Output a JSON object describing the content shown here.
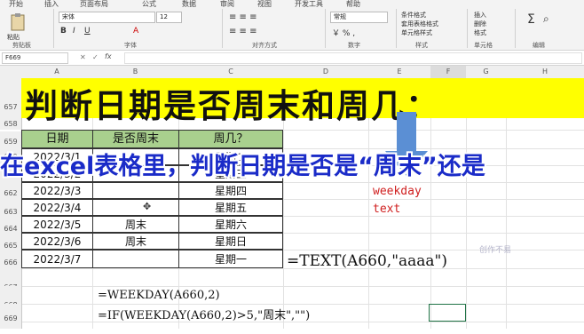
{
  "ribbon": {
    "tabs": [
      "开始",
      "插入",
      "页面布局",
      "公式",
      "数据",
      "审阅",
      "视图",
      "开发工具",
      "帮助"
    ],
    "font_name": "宋体",
    "font_size": "12",
    "number_format": "常规",
    "clipboard_label": "剪贴板",
    "font_label": "字体",
    "align_label": "对齐方式",
    "number_label": "数字",
    "styles_label": "样式",
    "cells_label": "单元格",
    "edit_label": "编辑",
    "cond_format": "条件格式",
    "table_format": "套用表格格式",
    "cell_style": "单元格样式",
    "insert": "插入",
    "delete": "删除",
    "format": "格式",
    "paste": "粘贴"
  },
  "name_box": "F669",
  "columns": [
    "A",
    "B",
    "C",
    "D",
    "E",
    "F",
    "G",
    "H"
  ],
  "rows": [
    "657",
    "658",
    "659",
    "660",
    "661",
    "662",
    "663",
    "664",
    "665",
    "666",
    "667",
    "668",
    "669"
  ],
  "title": "判断日期是否周末和周几：",
  "table": {
    "headers": [
      "日期",
      "是否周末",
      "周几？"
    ],
    "rows": [
      [
        "2022/3/1",
        "",
        "星期二"
      ],
      [
        "2022/3/2",
        "",
        "星期三"
      ],
      [
        "2022/3/3",
        "",
        "星期四"
      ],
      [
        "2022/3/4",
        "",
        "星期五"
      ],
      [
        "2022/3/5",
        "周末",
        "星期六"
      ],
      [
        "2022/3/6",
        "周末",
        "星期日"
      ],
      [
        "2022/3/7",
        "",
        "星期一"
      ]
    ]
  },
  "overlay_caption": "在excel表格里，判断日期是否是“周末”还是",
  "red_notes": [
    "weekday",
    "text"
  ],
  "formulas": {
    "text_formula": "=TEXT(A660,\"aaaa\")",
    "weekday_formula": "=WEEKDAY(A660,2)",
    "if_formula": "=IF(WEEKDAY(A660,2)>5,\"周末\",\"\")"
  },
  "watermark": "创作不易",
  "colors": {
    "banner": "#ffff00",
    "header_fill": "#a9d08e",
    "arrow": "#5b8fd4",
    "overlay_text": "#1a2bc8",
    "notes": "#d02020"
  }
}
